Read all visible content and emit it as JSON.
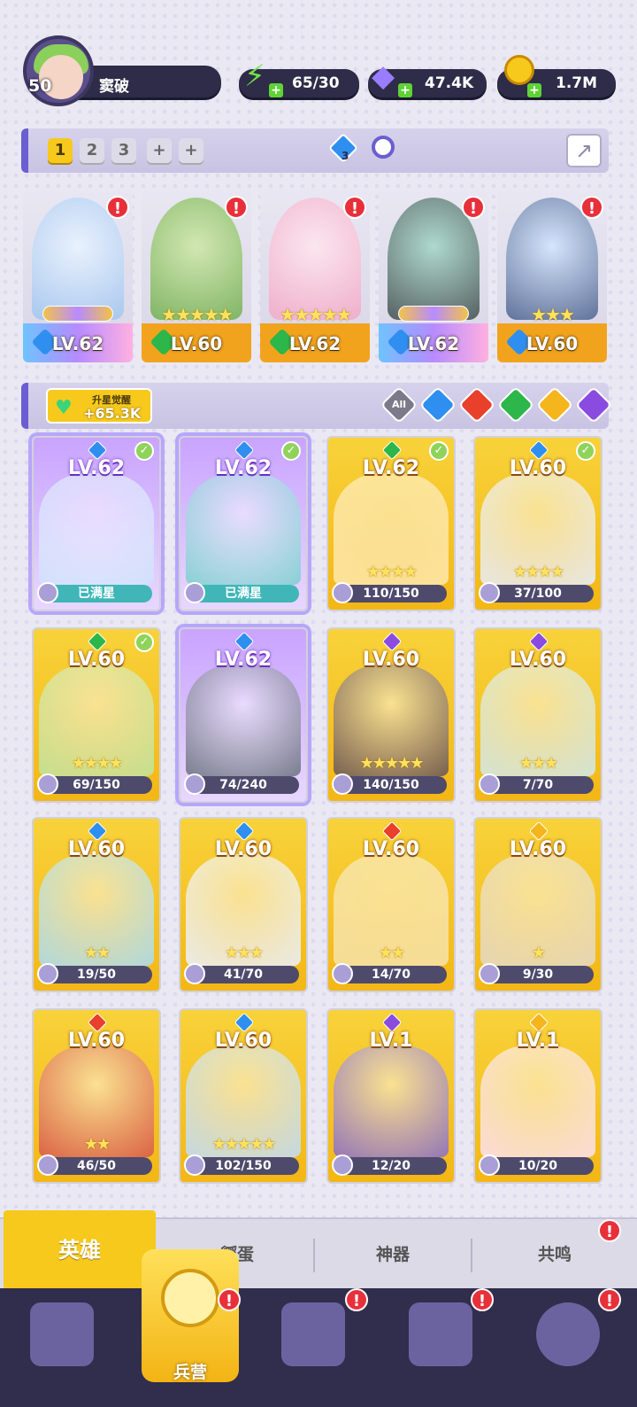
{
  "player": {
    "level": "50",
    "name": "窦破"
  },
  "resources": {
    "energy": "65/30",
    "gems": "47.4K",
    "gold": "1.7M"
  },
  "team_slots": [
    "1",
    "2",
    "3",
    "+",
    "+"
  ],
  "team_badge_count": "3",
  "team": [
    {
      "level": "LV.62",
      "stars": "",
      "winged": true
    },
    {
      "level": "LV.60",
      "stars": "★★★★★",
      "winged": false
    },
    {
      "level": "LV.62",
      "stars": "★★★★★",
      "winged": false
    },
    {
      "level": "LV.62",
      "stars": "",
      "winged": true
    },
    {
      "level": "LV.60",
      "stars": "★★★",
      "winged": false
    }
  ],
  "star_awaken": {
    "label": "升星觉醒",
    "value": "+65.3K"
  },
  "filters": [
    "All"
  ],
  "heroes": [
    {
      "level": "LV.62",
      "progress": "已满星"
    },
    {
      "level": "LV.62",
      "progress": "已满星"
    },
    {
      "level": "LV.62",
      "progress": "110/150"
    },
    {
      "level": "LV.60",
      "progress": "37/100"
    },
    {
      "level": "LV.60",
      "progress": "69/150"
    },
    {
      "level": "LV.62",
      "progress": "74/240"
    },
    {
      "level": "LV.60",
      "progress": "140/150"
    },
    {
      "level": "LV.60",
      "progress": "7/70"
    },
    {
      "level": "LV.60",
      "progress": "19/50"
    },
    {
      "level": "LV.60",
      "progress": "41/70"
    },
    {
      "level": "LV.60",
      "progress": "14/70"
    },
    {
      "level": "LV.60",
      "progress": "9/30"
    },
    {
      "level": "LV.60",
      "progress": "46/50"
    },
    {
      "level": "LV.60",
      "progress": "102/150"
    },
    {
      "level": "LV.1",
      "progress": "12/20"
    },
    {
      "level": "LV.1",
      "progress": "10/20"
    }
  ],
  "tabs": {
    "heroes": "英雄",
    "hatch": "孵蛋",
    "artifact": "神器",
    "resonance": "共鸣"
  },
  "nav": {
    "barracks": "兵营"
  },
  "alert_mark": "!",
  "colors": {
    "water": "#2f8ff0",
    "grass": "#2db64a",
    "fire": "#e8402a",
    "light": "#f5b51c",
    "dark": "#8a4ce0",
    "accent": "#f6c91c"
  }
}
